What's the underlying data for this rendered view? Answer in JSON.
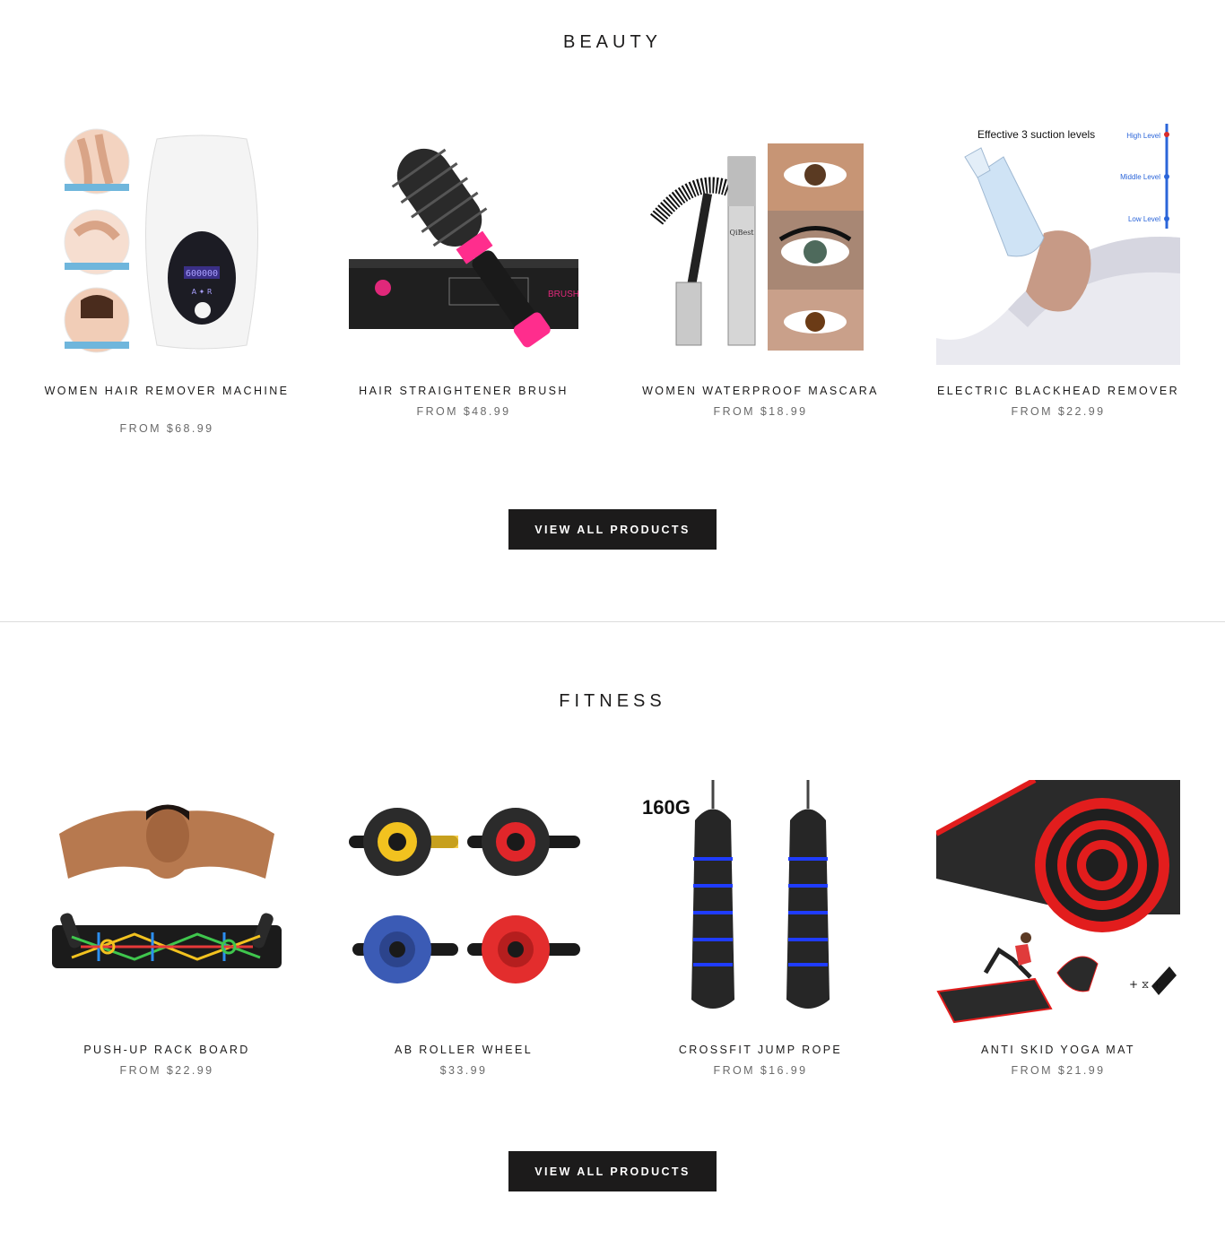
{
  "sections": [
    {
      "title": "BEAUTY",
      "button_label": "VIEW ALL PRODUCTS",
      "products": [
        {
          "name": "WOMEN HAIR REMOVER MACHINE",
          "price": "FROM $68.99",
          "image_icon": "hair-remover-device"
        },
        {
          "name": "HAIR STRAIGHTENER BRUSH",
          "price": "FROM $48.99",
          "image_icon": "hot-air-brush",
          "image_text": "BRUSH"
        },
        {
          "name": "WOMEN WATERPROOF MASCARA",
          "price": "FROM $18.99",
          "image_icon": "mascara-tube",
          "image_text": "QiBest"
        },
        {
          "name": "ELECTRIC BLACKHEAD REMOVER",
          "price": "FROM $22.99",
          "image_icon": "blackhead-vacuum",
          "image_text": "Effective 3 suction levels",
          "levels": [
            "High Level",
            "Middle Level",
            "Low Level"
          ]
        }
      ]
    },
    {
      "title": "FITNESS",
      "button_label": "VIEW ALL PRODUCTS",
      "products": [
        {
          "name": "PUSH-UP RACK BOARD",
          "price": "FROM $22.99",
          "image_icon": "push-up-board"
        },
        {
          "name": "AB ROLLER WHEEL",
          "price": "$33.99",
          "image_icon": "ab-roller-wheels"
        },
        {
          "name": "CROSSFIT JUMP ROPE",
          "price": "FROM $16.99",
          "image_icon": "jump-rope-handles",
          "image_text": "160G"
        },
        {
          "name": "ANTI SKID YOGA MAT",
          "price": "FROM $21.99",
          "image_icon": "yoga-mat-roll"
        }
      ]
    }
  ],
  "colors": {
    "button_bg": "#1c1b1b",
    "button_text": "#ffffff",
    "title_text": "#1c1b1b",
    "price_text": "#6a6a6a",
    "divider": "#dcdcdc"
  }
}
